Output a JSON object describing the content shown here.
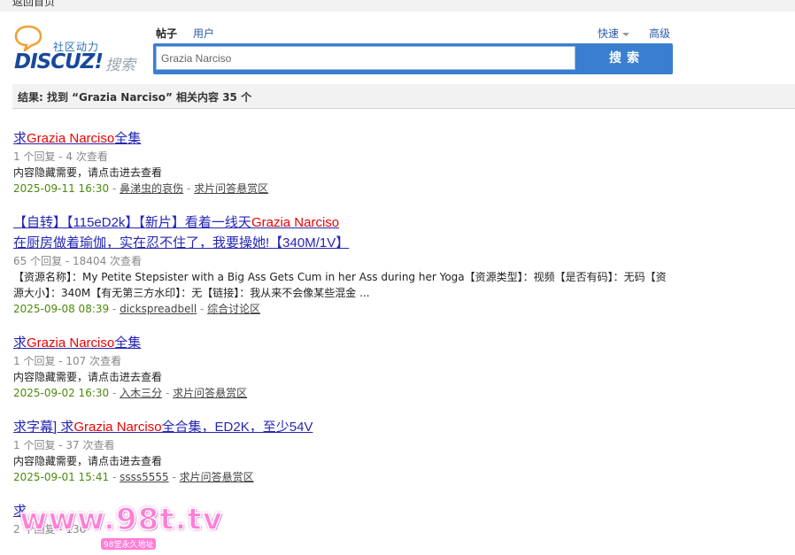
{
  "topbar": {
    "back_label": "返回首页"
  },
  "logo": {
    "cn_text": "社区动力",
    "brand": "DISCUZ!",
    "search_word": "搜索"
  },
  "tabs": {
    "posts": "帖子",
    "users": "用户"
  },
  "quick_label": "快速",
  "advanced_label": "高级",
  "search": {
    "value": "Grazia Narciso",
    "button_label": "搜索"
  },
  "result_summary": "结果: 找到 “Grazia Narciso” 相关内容 35 个",
  "results": [
    {
      "title_prefix": "求",
      "title_keyword": "Grazia Narciso",
      "title_suffix": "全集",
      "meta": "1 个回复 - 4 次查看",
      "excerpt": "内容隐藏需要，请点击进去查看",
      "date": "2025-09-11 16:30",
      "author": "鼻涕虫的哀伤",
      "forum": "求片问答悬赏区"
    },
    {
      "title_prefix": "【自转】【115eD2k】【新片】看着一线天",
      "title_keyword": "Grazia Narciso",
      "title_suffix": "在厨房做着瑜伽，实在忍不住了，我要操她!【340M/1V】",
      "meta": "65 个回复 - 18404 次查看",
      "excerpt": "【资源名称】：My Petite Stepsister with a Big Ass Gets Cum in her Ass during her Yoga【资源类型】：视频【是否有码】：无码【资源大小】：340M【有无第三方水印】：无【链接】：我从来不会像某些混金 ...",
      "date": "2025-09-08 08:39",
      "author": "dickspreadbell",
      "forum": "综合讨论区"
    },
    {
      "title_prefix": "求",
      "title_keyword": "Grazia Narciso",
      "title_suffix": "全集",
      "meta": "1 个回复 - 107 次查看",
      "excerpt": "内容隐藏需要，请点击进去查看",
      "date": "2025-09-02 16:30",
      "author": "入木三分",
      "forum": "求片问答悬赏区"
    },
    {
      "title_prefix": "求字幕] 求",
      "title_keyword": "Grazia Narciso",
      "title_suffix": "全合集，ED2K，至少54V",
      "meta": "1 个回复 - 37 次查看",
      "excerpt": "内容隐藏需要，请点击进去查看",
      "date": "2025-09-01 15:41",
      "author": "ssss5555",
      "forum": "求片问答悬赏区"
    },
    {
      "title_prefix": "求",
      "title_keyword": "",
      "title_suffix": "",
      "meta": "2 个回复 - 136",
      "excerpt": "",
      "date": "",
      "author": "",
      "forum": ""
    }
  ],
  "watermark": {
    "url_text": "www.98t.tv",
    "sub_text": "98堂永久地址"
  },
  "colors": {
    "search_bar": "#3a7fcf",
    "keyword": "#ee0000",
    "link": "#2525b5",
    "date": "#4b8b0b"
  }
}
